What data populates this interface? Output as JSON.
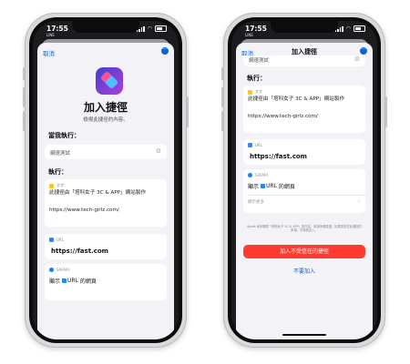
{
  "common": {
    "time": "17:55",
    "carrier": "LINE",
    "cancel": "取消"
  },
  "left": {
    "title": "加入捷徑",
    "subtitle": "檢視此捷徑的內容。",
    "when_run_label": "當我執行：",
    "input_value": "網速測試",
    "run_label": "執行：",
    "text_tag": "文字",
    "text_body": "此捷徑由「塔科女子 3C & APP」網站製作",
    "text_url": "https://www.tech-girlz.com/",
    "url_tag": "URL",
    "url_value": "https://fast.com",
    "safari_tag": "SAFARI",
    "show_prefix": "顯示",
    "show_chip": "URL",
    "show_suffix": "的網頁"
  },
  "right": {
    "bar_title": "加入捷徑",
    "input_value": "網速測試",
    "run_label": "執行：",
    "text_tag": "文字",
    "text_body": "此捷徑由「塔科女子 3C & APP」網站製作",
    "text_url": "https://www.tech-girlz.com/",
    "url_tag": "URL",
    "url_value": "https://fast.com",
    "safari_tag": "SAFARI",
    "show_prefix": "顯示",
    "show_chip": "URL",
    "show_suffix": "的網頁",
    "show_more": "顯示更多",
    "notice": "Apple 尚未審閱「塔科女子 3C & APP」的內容，來源未經驗證。如果您信任此捷徑的來源，才將其加入。",
    "add_untrusted": "加入不受信任的捷徑",
    "dont_add": "不要加入"
  },
  "colors": {
    "accent": "#0a64d8",
    "danger": "#ff3b30",
    "text_tag_color": "#f5c518",
    "url_tag_color": "#2e87f0"
  }
}
